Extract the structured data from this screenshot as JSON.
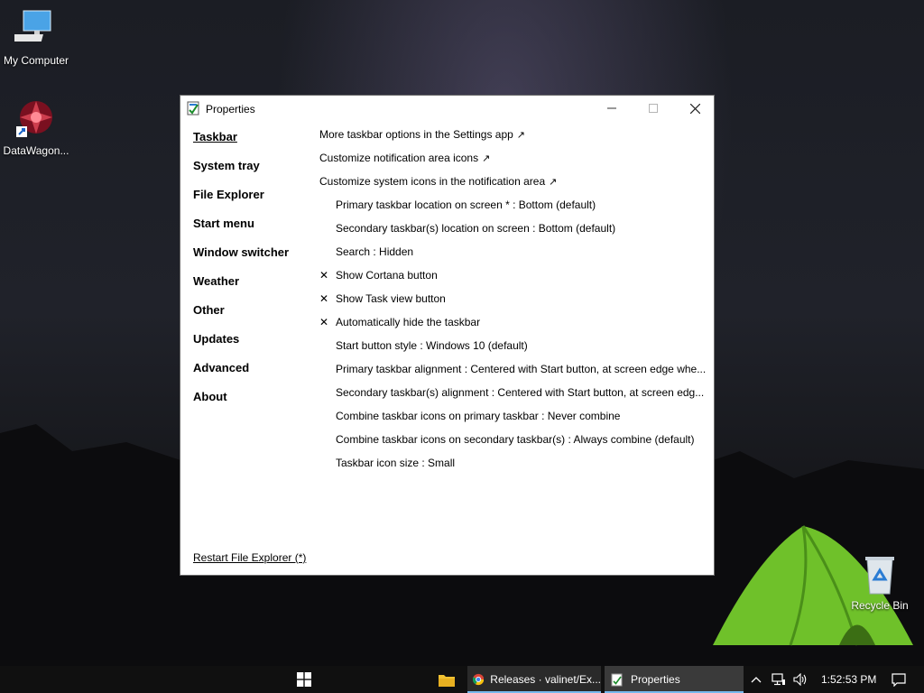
{
  "desktop": {
    "icons": [
      {
        "label": "My Computer"
      },
      {
        "label": "DataWagon..."
      },
      {
        "label": "Recycle Bin"
      }
    ]
  },
  "window": {
    "title": "Properties",
    "nav": [
      {
        "label": "Taskbar",
        "active": true
      },
      {
        "label": "System tray"
      },
      {
        "label": "File Explorer"
      },
      {
        "label": "Start menu"
      },
      {
        "label": "Window switcher"
      },
      {
        "label": "Weather"
      },
      {
        "label": "Other"
      },
      {
        "label": "Updates"
      },
      {
        "label": "Advanced"
      },
      {
        "label": "About"
      }
    ],
    "settings": [
      {
        "label": "More taskbar options in the Settings app",
        "link": true
      },
      {
        "label": "Customize notification area icons",
        "link": true
      },
      {
        "label": "Customize system icons in the notification area",
        "link": true
      },
      {
        "label": "Primary taskbar location on screen * : Bottom (default)"
      },
      {
        "label": "Secondary taskbar(s) location on screen : Bottom (default)"
      },
      {
        "label": "Search : Hidden"
      },
      {
        "label": "Show Cortana button",
        "checked": true
      },
      {
        "label": "Show Task view button",
        "checked": true
      },
      {
        "label": "Automatically hide the taskbar",
        "checked": true
      },
      {
        "label": "Start button style : Windows 10 (default)"
      },
      {
        "label": "Primary taskbar alignment : Centered with Start button, at screen edge whe..."
      },
      {
        "label": "Secondary taskbar(s) alignment : Centered with Start button, at screen edg..."
      },
      {
        "label": "Combine taskbar icons on primary taskbar : Never combine"
      },
      {
        "label": "Combine taskbar icons on secondary taskbar(s) : Always combine (default)"
      },
      {
        "label": "Taskbar icon size : Small"
      }
    ],
    "link_arrow": "↗",
    "check_mark": "✕",
    "restart_label": "Restart File Explorer (*)"
  },
  "taskbar": {
    "chrome_label": "Releases · valinet/Ex...",
    "properties_label": "Properties",
    "clock": "1:52:53 PM",
    "accent": "#76b9ed"
  }
}
